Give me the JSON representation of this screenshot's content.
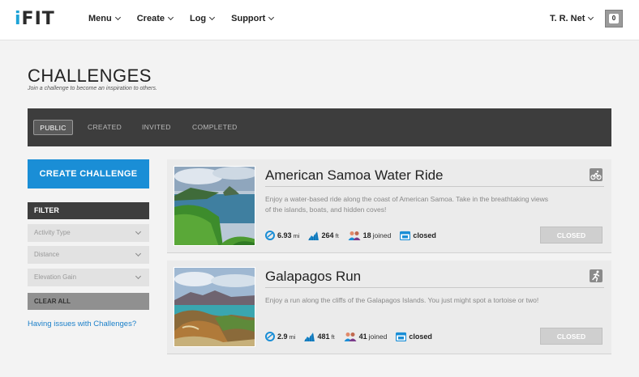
{
  "brand": {
    "logo_first": "i",
    "logo_rest": "FIT"
  },
  "nav": {
    "menu_label": "Menu",
    "create_label": "Create",
    "log_label": "Log",
    "support_label": "Support",
    "user_label": "T. R. Net",
    "notification_count": "0"
  },
  "page": {
    "title": "CHALLENGES",
    "subtitle": "Join a challenge to become an inspiration to others."
  },
  "tabs": [
    {
      "label": "PUBLIC",
      "active": true
    },
    {
      "label": "CREATED",
      "active": false
    },
    {
      "label": "INVITED",
      "active": false
    },
    {
      "label": "COMPLETED",
      "active": false
    }
  ],
  "sidebar": {
    "create_label": "CREATE CHALLENGE",
    "filter_label": "FILTER",
    "filters": [
      {
        "placeholder": "Activity Type"
      },
      {
        "placeholder": "Distance"
      },
      {
        "placeholder": "Elevation Gain"
      }
    ],
    "clear_label": "CLEAR ALL",
    "help_link": "Having issues with Challenges?"
  },
  "challenges": [
    {
      "title": "American Samoa Water Ride",
      "description": "Enjoy a water-based ride along the coast of American Samoa. Take in the breathtaking views of the islands, boats, and hidden coves!",
      "activity_icon": "bike-icon",
      "distance": "6.93",
      "distance_unit": "mi",
      "elevation": "264",
      "elevation_unit": "ft",
      "joined": "18",
      "joined_label": "joined",
      "status": "closed",
      "button_label": "CLOSED"
    },
    {
      "title": "Galapagos Run",
      "description": "Enjoy a run along the cliffs of the Galapagos Islands. You just might spot a tortoise or two!",
      "activity_icon": "run-icon",
      "distance": "2.9",
      "distance_unit": "mi",
      "elevation": "481",
      "elevation_unit": "ft",
      "joined": "41",
      "joined_label": "joined",
      "status": "closed",
      "button_label": "CLOSED"
    }
  ],
  "colors": {
    "accent": "#1a8ed6",
    "dark_bar": "#3d3d3d",
    "logo_accent": "#1ea3d7"
  }
}
